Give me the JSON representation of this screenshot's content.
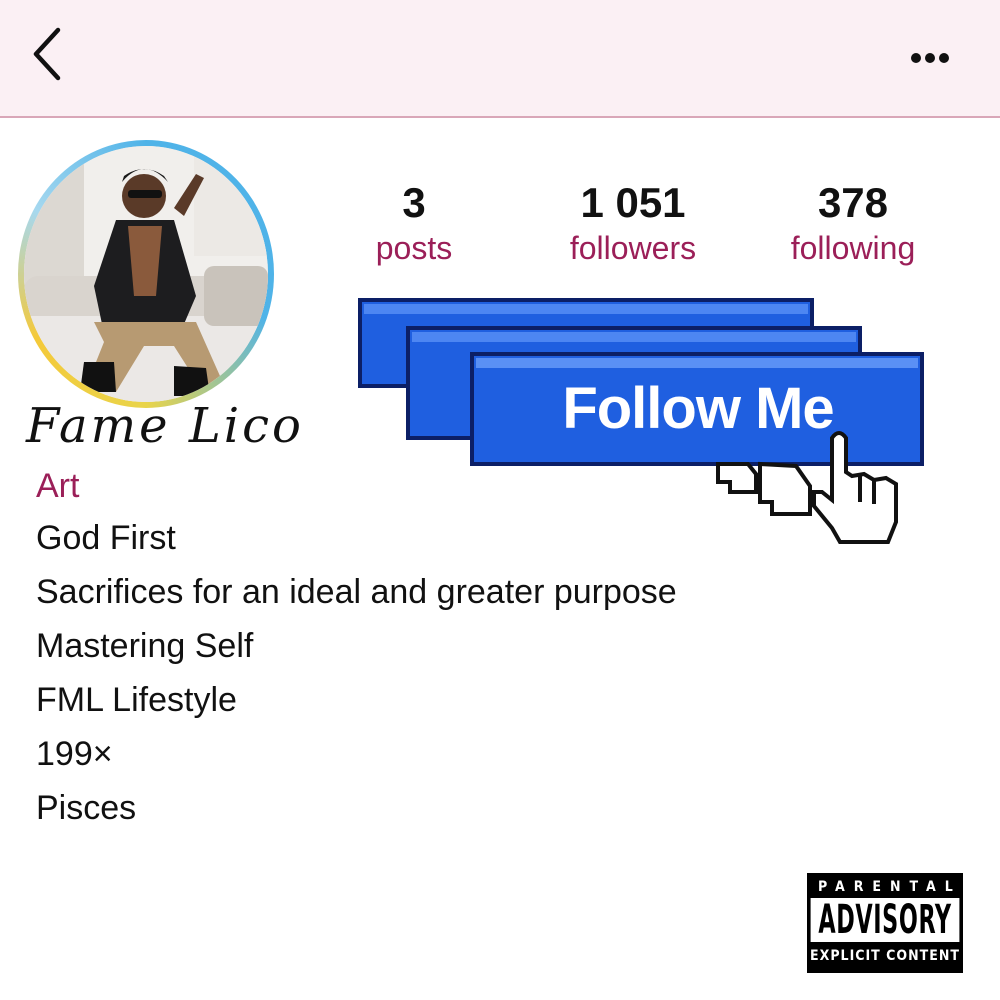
{
  "nav": {
    "back_icon": "chevron-left-icon",
    "more_icon": "more-horizontal-icon"
  },
  "profile": {
    "display_name": "Fame Lico",
    "category": "Art",
    "bio": [
      "God First",
      "Sacrifices for an ideal and greater purpose",
      "Mastering Self",
      "FML Lifestyle",
      "199×",
      "Pisces"
    ]
  },
  "stats": [
    {
      "count": "3",
      "label": "posts"
    },
    {
      "count": "1 051",
      "label": "followers"
    },
    {
      "count": "378",
      "label": "following"
    }
  ],
  "follow_button": {
    "label": "Follow Me"
  },
  "advisory": {
    "top": "PARENTAL",
    "middle": "ADVISORY",
    "bottom": "EXPLICIT CONTENT"
  },
  "colors": {
    "header_bg": "#fbf0f4",
    "accent": "#9b1f58",
    "button_blue": "#1f5fe0"
  }
}
